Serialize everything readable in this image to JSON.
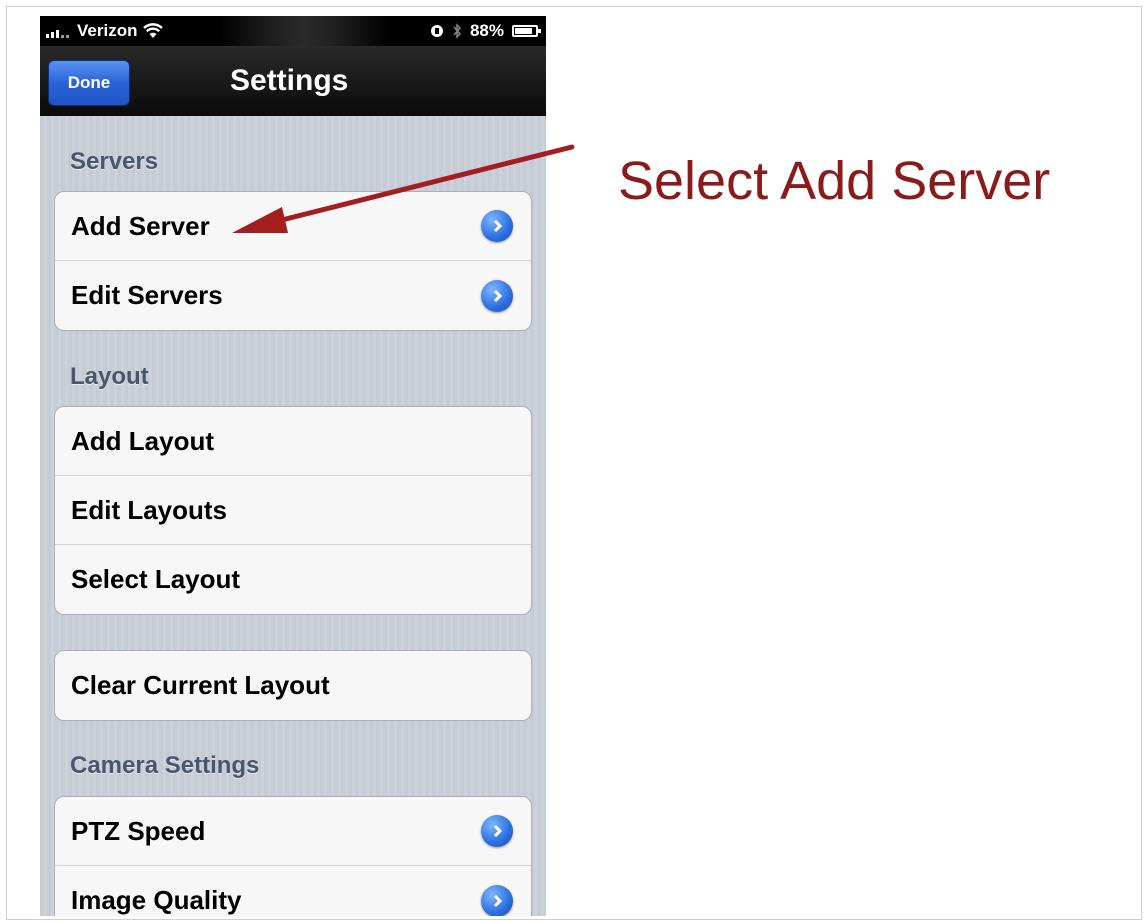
{
  "status": {
    "carrier": "Verizon",
    "battery": "88%"
  },
  "navbar": {
    "done_label": "Done",
    "title": "Settings"
  },
  "sections": {
    "servers": {
      "header": "Servers",
      "items": [
        "Add Server",
        "Edit Servers"
      ]
    },
    "layout": {
      "header": "Layout",
      "items": [
        "Add Layout",
        "Edit Layouts",
        "Select Layout"
      ]
    },
    "clear": {
      "items": [
        "Clear Current Layout"
      ]
    },
    "camera": {
      "header": "Camera Settings",
      "items": [
        "PTZ Speed",
        "Image Quality"
      ]
    }
  },
  "annotation": {
    "text": "Select Add Server",
    "color": "#8b1a1a"
  },
  "icons": [
    "wifi-icon",
    "lock-rotation-icon",
    "bluetooth-icon",
    "battery-icon",
    "disclosure-chevron-icon",
    "arrow-icon"
  ]
}
